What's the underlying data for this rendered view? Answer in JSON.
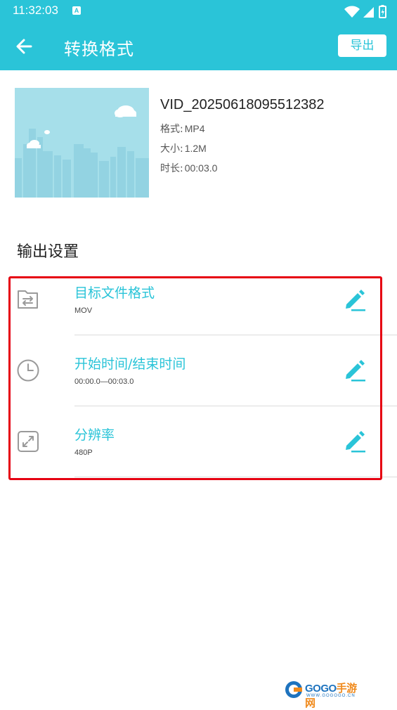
{
  "status_bar": {
    "time": "11:32:03",
    "notification_glyph": "A",
    "icons": [
      "wifi-icon",
      "signal-icon",
      "battery-icon"
    ]
  },
  "app_bar": {
    "title": "转换格式",
    "export_label": "导出",
    "back_icon": "arrow-left-icon"
  },
  "video": {
    "file_name": "VID_20250618095512382",
    "format_label": "格式:",
    "format_value": "MP4",
    "size_label": "大小:",
    "size_value": "1.2M",
    "duration_label": "时长:",
    "duration_value": "00:03.0"
  },
  "output_settings": {
    "title": "输出设置",
    "items": [
      {
        "icon": "folder-swap-icon",
        "title": "目标文件格式",
        "value": "MOV"
      },
      {
        "icon": "clock-icon",
        "title": "开始时间/结束时间",
        "value": "00:00.0—00:03.0"
      },
      {
        "icon": "resize-icon",
        "title": "分辨率",
        "value": "480P"
      }
    ]
  },
  "watermark": {
    "text_a": "GOGO",
    "text_b": "手游网",
    "sub": "WWW.GOGOGO.CN"
  },
  "colors": {
    "accent": "#2ac4d8",
    "highlight_frame": "#e60012"
  }
}
